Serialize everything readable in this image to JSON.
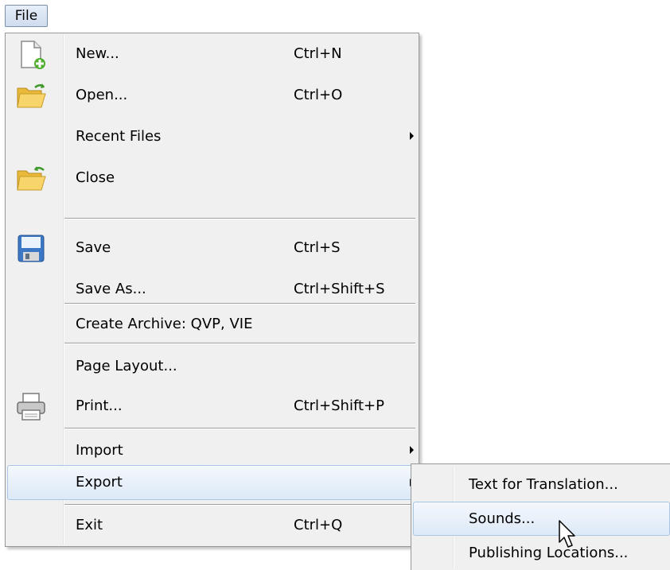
{
  "menubar": {
    "file_label": "File"
  },
  "file_menu": {
    "new": {
      "label": "New...",
      "shortcut": "Ctrl+N"
    },
    "open": {
      "label": "Open...",
      "shortcut": "Ctrl+O"
    },
    "recent": {
      "label": "Recent Files"
    },
    "close": {
      "label": "Close"
    },
    "save": {
      "label": "Save",
      "shortcut": "Ctrl+S"
    },
    "save_as": {
      "label": "Save As...",
      "shortcut": "Ctrl+Shift+S"
    },
    "archive": {
      "label": "Create Archive: QVP, VIE"
    },
    "page_layout": {
      "label": "Page Layout..."
    },
    "print": {
      "label": "Print...",
      "shortcut": "Ctrl+Shift+P"
    },
    "import": {
      "label": "Import"
    },
    "export": {
      "label": "Export"
    },
    "exit": {
      "label": "Exit",
      "shortcut": "Ctrl+Q"
    }
  },
  "export_submenu": {
    "text_translation": {
      "label": "Text for Translation..."
    },
    "sounds": {
      "label": "Sounds..."
    },
    "publishing_locations": {
      "label": "Publishing Locations..."
    }
  },
  "colors": {
    "menu_bg": "#f0f0f0",
    "highlight_border": "#a8c7e8",
    "highlight_bg": "#dde9f7"
  }
}
